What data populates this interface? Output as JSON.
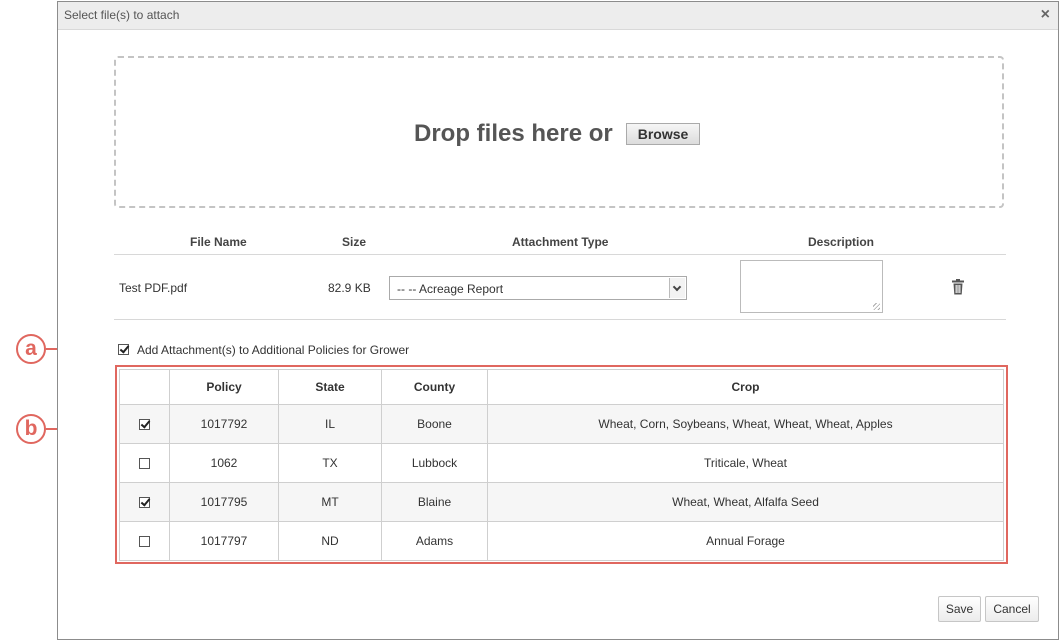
{
  "dialog": {
    "title": "Select file(s) to attach",
    "close_icon": "close-icon"
  },
  "dropzone": {
    "text": "Drop files here or",
    "browse_label": "Browse"
  },
  "file_table": {
    "headers": [
      "File Name",
      "Size",
      "Attachment Type",
      "Description"
    ],
    "row": {
      "file_name": "Test PDF.pdf",
      "size": "82.9 KB",
      "attachment_type": "-- -- Acreage Report",
      "description": "",
      "delete_icon": "trash-icon"
    }
  },
  "additional": {
    "label": "Add Attachment(s) to Additional Policies for Grower",
    "checked": true
  },
  "policy_table": {
    "headers": [
      "",
      "Policy",
      "State",
      "County",
      "Crop"
    ],
    "rows": [
      {
        "checked": true,
        "policy": "1017792",
        "state": "IL",
        "county": "Boone",
        "crop": "Wheat, Corn, Soybeans, Wheat, Wheat, Wheat, Apples"
      },
      {
        "checked": false,
        "policy": "1062",
        "state": "TX",
        "county": "Lubbock",
        "crop": "Triticale, Wheat"
      },
      {
        "checked": true,
        "policy": "1017795",
        "state": "MT",
        "county": "Blaine",
        "crop": "Wheat, Wheat, Alfalfa Seed"
      },
      {
        "checked": false,
        "policy": "1017797",
        "state": "ND",
        "county": "Adams",
        "crop": "Annual Forage"
      }
    ]
  },
  "callouts": {
    "a": "a",
    "b": "b"
  },
  "buttons": {
    "save": "Save",
    "cancel": "Cancel"
  },
  "colors": {
    "accent": "#e0675f"
  }
}
